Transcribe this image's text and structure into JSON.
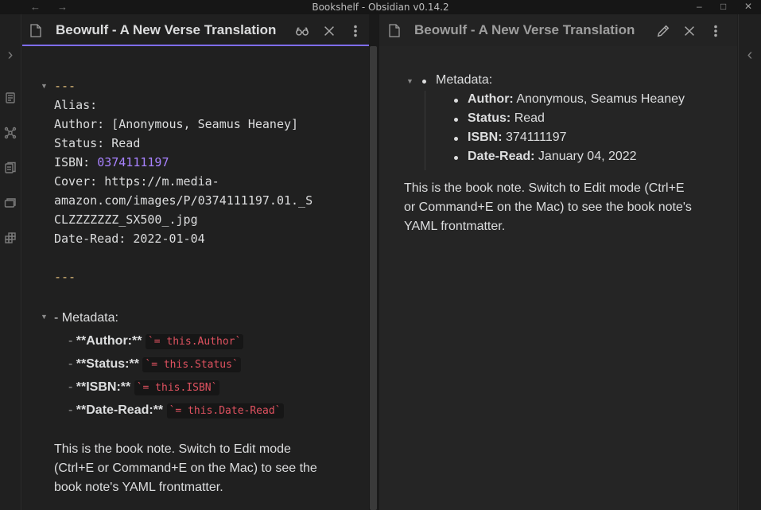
{
  "window": {
    "title": "Bookshelf - Obsidian v0.14.2",
    "back_glyph": "←",
    "forward_glyph": "→",
    "minimize_glyph": "–",
    "maximize_glyph": "□",
    "close_glyph": "✕"
  },
  "ribbon_left": {
    "expand_glyph": "›",
    "icons": [
      "file-switcher-icon",
      "graph-view-icon",
      "templates-icon",
      "slides-icon",
      "dataview-icon"
    ]
  },
  "ribbon_right": {
    "collapse_glyph": "‹"
  },
  "left_pane": {
    "tab_title": "Beowulf - A New Verse Translation",
    "mode": "edit",
    "frontmatter": {
      "open_delim": "---",
      "alias_label": "Alias:",
      "author_label": "Author:",
      "author_value": "[Anonymous, Seamus Heaney]",
      "status_label": "Status:",
      "status_value": "Read",
      "isbn_label": "ISBN:",
      "isbn_value": "0374111197",
      "cover_label": "Cover:",
      "cover_line1": "https://m.media-",
      "cover_line2": "amazon.com/images/P/0374111197.01._S",
      "cover_line3": "CLZZZZZZZ_SX500_.jpg",
      "dateread_label": "Date-Read:",
      "dateread_value": "2022-01-04",
      "close_delim": "---"
    },
    "metadata_heading": "- Metadata:",
    "metadata_items": [
      {
        "label": "**Author:**",
        "code": "`= this.Author`"
      },
      {
        "label": "**Status:**",
        "code": "`= this.Status`"
      },
      {
        "label": "**ISBN:**",
        "code": "`= this.ISBN`"
      },
      {
        "label": "**Date-Read:**",
        "code": "`= this.Date-Read`"
      }
    ],
    "body_lines": [
      "This is the book note. Switch to Edit mode",
      "(Ctrl+E or Command+E on the Mac) to see the",
      "book note's YAML frontmatter."
    ]
  },
  "right_pane": {
    "tab_title": "Beowulf - A New Verse Translation",
    "mode": "preview",
    "metadata_heading": "Metadata:",
    "metadata_items": [
      {
        "label": "Author:",
        "value": "Anonymous, Seamus Heaney"
      },
      {
        "label": "Status:",
        "value": "Read"
      },
      {
        "label": "ISBN:",
        "value": "374111197"
      },
      {
        "label": "Date-Read:",
        "value": "January 04, 2022"
      }
    ],
    "body_lines": [
      "This is the book note. Switch to Edit mode (Ctrl+E",
      "or Command+E on the Mac) to see the book note's",
      "YAML frontmatter."
    ]
  },
  "colors": {
    "accent": "#7f6df2",
    "frontmatter_delim": "#e5c07b",
    "number": "#a882ff",
    "inline_code": "#e05260"
  }
}
